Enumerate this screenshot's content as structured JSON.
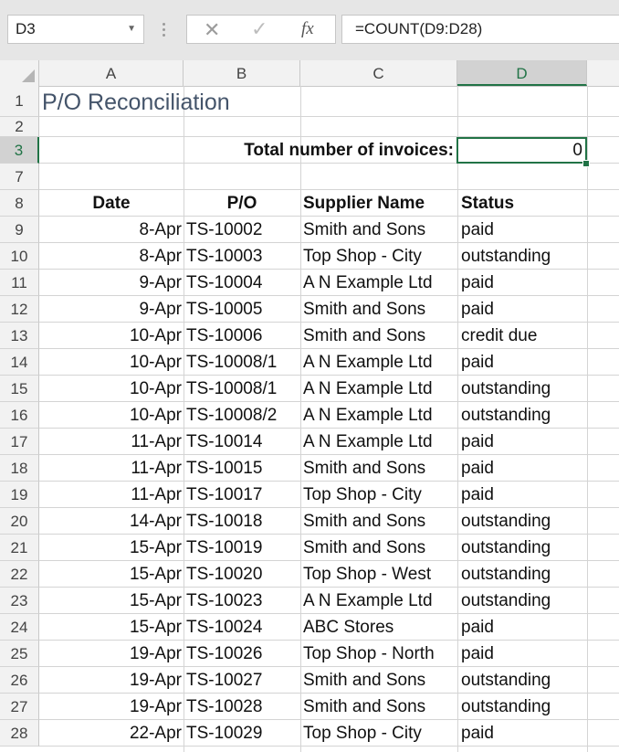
{
  "name_box": "D3",
  "formula": "=COUNT(D9:D28)",
  "columns": [
    "A",
    "B",
    "C",
    "D"
  ],
  "title": "P/O Reconciliation",
  "total_label": "Total number of invoices:",
  "total_value": "0",
  "headers": {
    "date": "Date",
    "po": "P/O",
    "supplier": "Supplier Name",
    "status": "Status"
  },
  "row_numbers": [
    "1",
    "2",
    "3",
    "7",
    "8",
    "9",
    "10",
    "11",
    "12",
    "13",
    "14",
    "15",
    "16",
    "17",
    "18",
    "19",
    "20",
    "21",
    "22",
    "23",
    "24",
    "25",
    "26",
    "27",
    "28"
  ],
  "rows": [
    {
      "date": "8-Apr",
      "po": "TS-10002",
      "supplier": "Smith and Sons",
      "status": "paid"
    },
    {
      "date": "8-Apr",
      "po": "TS-10003",
      "supplier": "Top Shop - City",
      "status": "outstanding"
    },
    {
      "date": "9-Apr",
      "po": "TS-10004",
      "supplier": "A N Example Ltd",
      "status": "paid"
    },
    {
      "date": "9-Apr",
      "po": "TS-10005",
      "supplier": "Smith and Sons",
      "status": "paid"
    },
    {
      "date": "10-Apr",
      "po": "TS-10006",
      "supplier": "Smith and Sons",
      "status": "credit due"
    },
    {
      "date": "10-Apr",
      "po": "TS-10008/1",
      "supplier": "A N Example Ltd",
      "status": "paid"
    },
    {
      "date": "10-Apr",
      "po": "TS-10008/1",
      "supplier": "A N Example Ltd",
      "status": "outstanding"
    },
    {
      "date": "10-Apr",
      "po": "TS-10008/2",
      "supplier": "A N Example Ltd",
      "status": "outstanding"
    },
    {
      "date": "11-Apr",
      "po": "TS-10014",
      "supplier": "A N Example Ltd",
      "status": "paid"
    },
    {
      "date": "11-Apr",
      "po": "TS-10015",
      "supplier": "Smith and Sons",
      "status": "paid"
    },
    {
      "date": "11-Apr",
      "po": "TS-10017",
      "supplier": "Top Shop - City",
      "status": "paid"
    },
    {
      "date": "14-Apr",
      "po": "TS-10018",
      "supplier": "Smith and Sons",
      "status": "outstanding"
    },
    {
      "date": "15-Apr",
      "po": "TS-10019",
      "supplier": "Smith and Sons",
      "status": "outstanding"
    },
    {
      "date": "15-Apr",
      "po": "TS-10020",
      "supplier": "Top Shop - West",
      "status": "outstanding"
    },
    {
      "date": "15-Apr",
      "po": "TS-10023",
      "supplier": "A N Example Ltd",
      "status": "outstanding"
    },
    {
      "date": "15-Apr",
      "po": "TS-10024",
      "supplier": "ABC Stores",
      "status": "paid"
    },
    {
      "date": "19-Apr",
      "po": "TS-10026",
      "supplier": "Top Shop - North",
      "status": "paid"
    },
    {
      "date": "19-Apr",
      "po": "TS-10027",
      "supplier": "Smith and Sons",
      "status": "outstanding"
    },
    {
      "date": "19-Apr",
      "po": "TS-10028",
      "supplier": "Smith and Sons",
      "status": "outstanding"
    },
    {
      "date": "22-Apr",
      "po": "TS-10029",
      "supplier": "Top Shop - City",
      "status": "paid"
    }
  ],
  "accent_color": "#217346",
  "title_color": "#44546a"
}
